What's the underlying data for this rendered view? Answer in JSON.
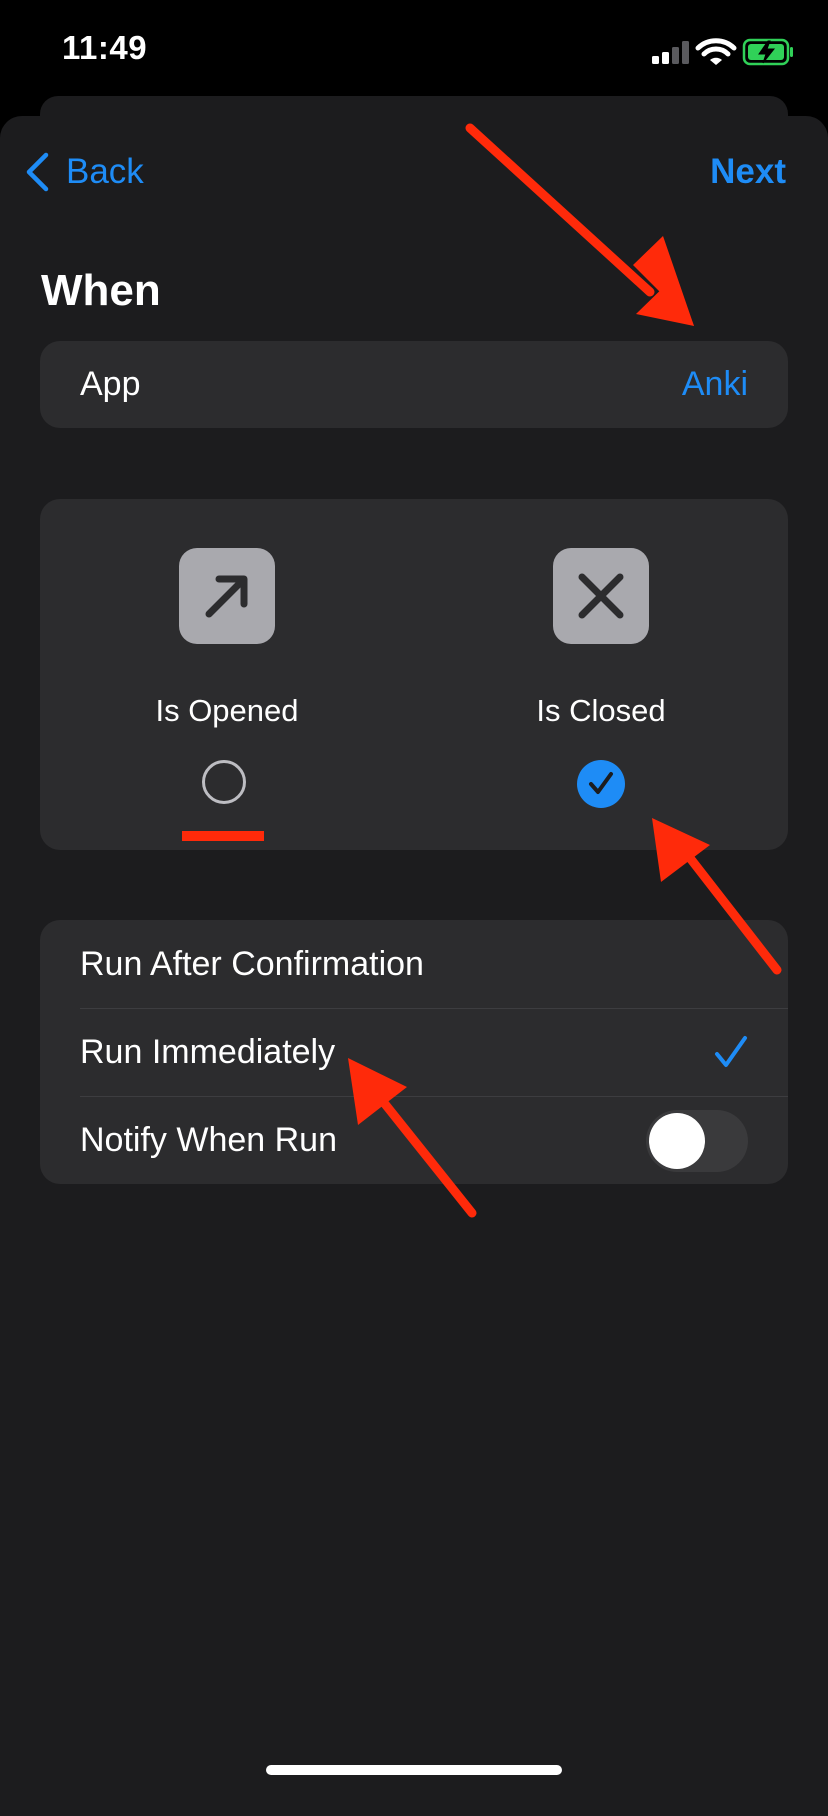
{
  "status_bar": {
    "time": "11:49",
    "icons": [
      "signal-icon",
      "wifi-icon",
      "battery-charging-icon"
    ]
  },
  "nav": {
    "back_label": "Back",
    "next_label": "Next"
  },
  "section_title": "When",
  "app_row": {
    "label": "App",
    "value": "Anki"
  },
  "trigger_options": [
    {
      "label": "Is Opened",
      "icon": "arrow-up-right-icon",
      "selected": false
    },
    {
      "label": "Is Closed",
      "icon": "x-mark-icon",
      "selected": true
    }
  ],
  "run_options": [
    {
      "label": "Run After Confirmation",
      "selected": false
    },
    {
      "label": "Run Immediately",
      "selected": true
    }
  ],
  "notify": {
    "label": "Notify When Run",
    "enabled": false
  },
  "colors": {
    "accent": "#1e8cf6",
    "annotation": "#ff2a0a",
    "background": "#1c1c1e",
    "card": "#2c2c2e"
  }
}
